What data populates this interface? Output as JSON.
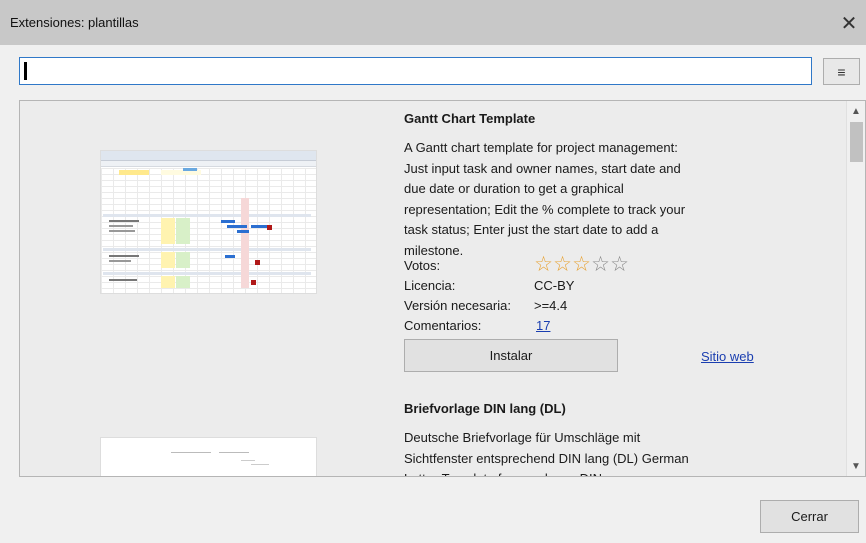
{
  "window": {
    "title": "Extensiones: plantillas",
    "close_glyph": "✕"
  },
  "search": {
    "value": "",
    "placeholder": ""
  },
  "menu_button": {
    "glyph": "≡"
  },
  "extensions": [
    {
      "name": "Gantt Chart Template",
      "description": "A Gantt chart template for project management: Just input task and owner names, start date and due date or duration to get a graphical representation; Edit the % complete to track your task status; Enter just the start date to add a milestone.",
      "votes_label": "Votos:",
      "rating": 3,
      "rating_max": 5,
      "license_label": "Licencia:",
      "license": "CC-BY",
      "version_label": "Versión necesaria:",
      "version": ">=4.4",
      "comments_label": "Comentarios:",
      "comments": "17",
      "install_label": "Instalar",
      "website_label": "Sitio web"
    },
    {
      "name": "Briefvorlage DIN lang (DL)",
      "description": "Deutsche Briefvorlage für Umschläge mit Sichtfenster entsprechend DIN lang (DL) German Letter-Template for envelopes DIN"
    }
  ],
  "footer": {
    "close_label": "Cerrar"
  },
  "colors": {
    "accent": "#2f78c8",
    "link": "#1a3eb0",
    "star": "#e8a334"
  }
}
